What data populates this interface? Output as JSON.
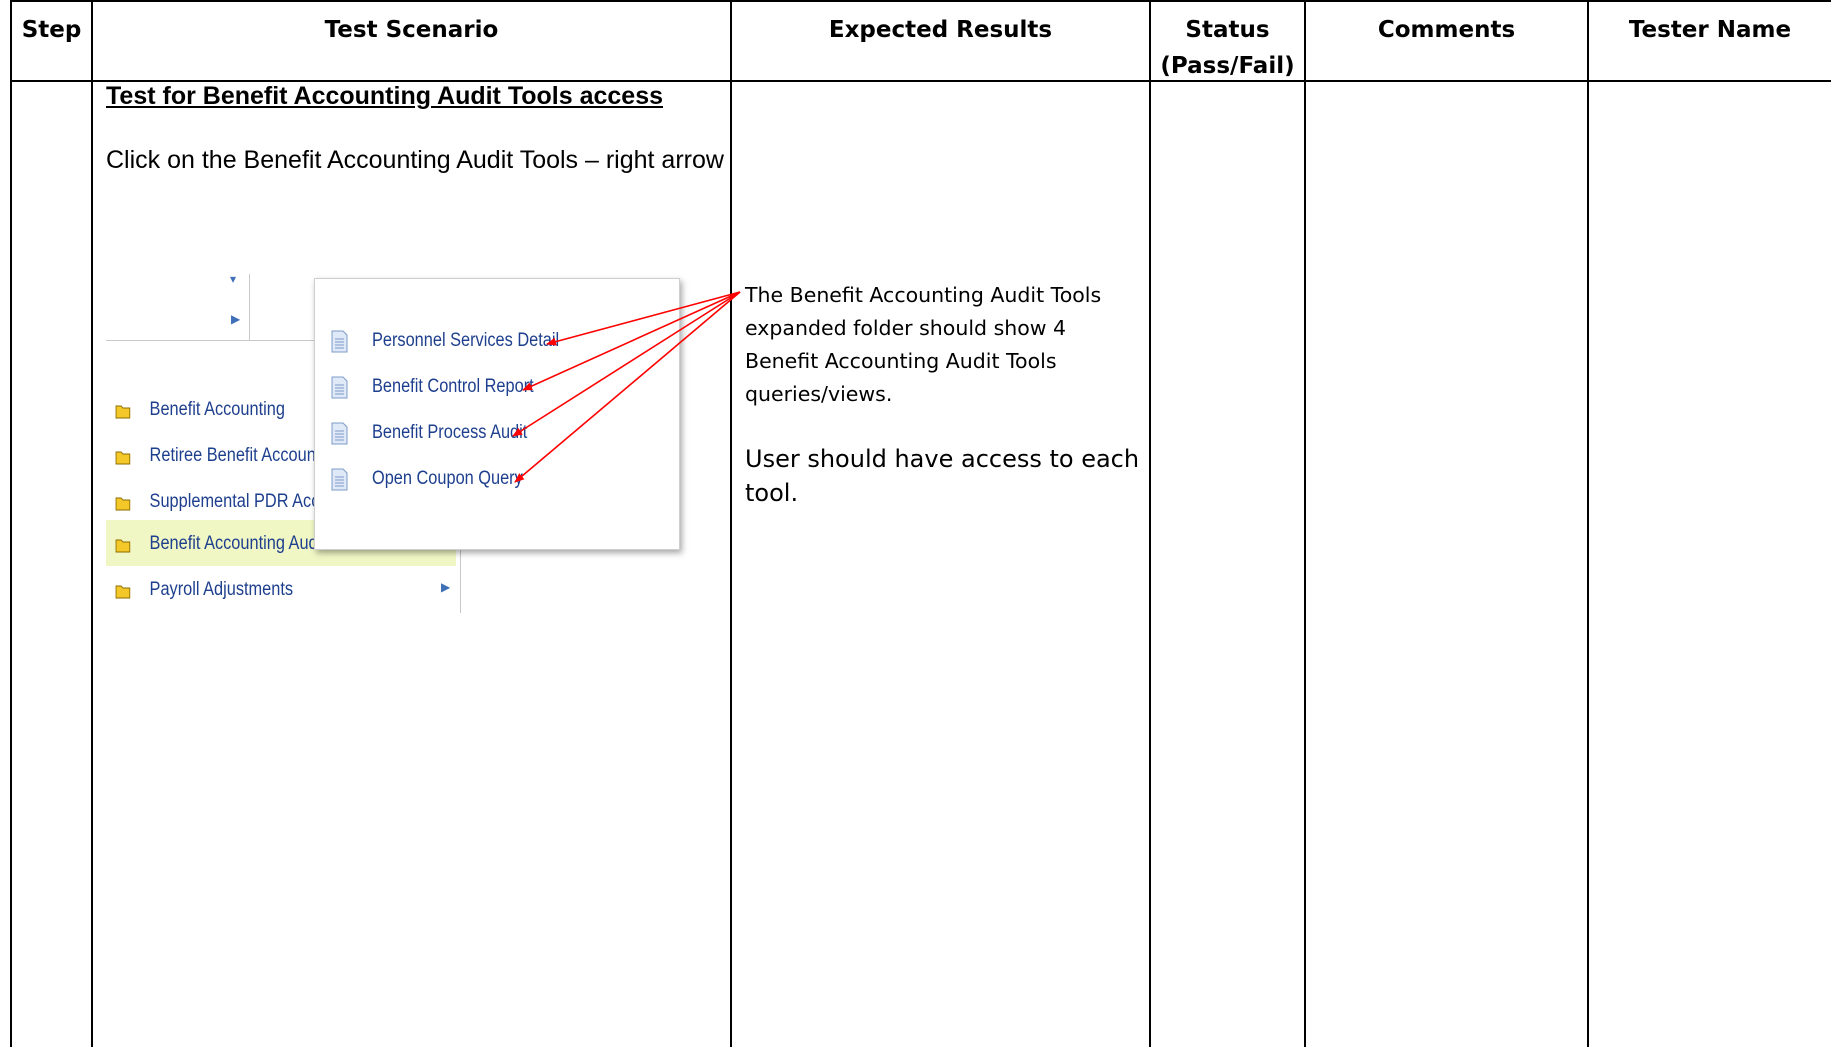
{
  "table": {
    "headers": {
      "step": "Step",
      "scenario": "Test Scenario",
      "expected": "Expected Results",
      "status_line1": "Status",
      "status_line2": "(Pass/Fail)",
      "comments": "Comments",
      "tester": "Tester Name"
    }
  },
  "scenario": {
    "title": "Test for Benefit Accounting Audit Tools access",
    "instruction": "Click on the Benefit Accounting Audit Tools – right arrow"
  },
  "expected": {
    "paragraph1": "The Benefit Accounting Audit Tools expanded folder should show 4 Benefit Accounting Audit Tools queries/views.",
    "paragraph2": "User should have access to each tool."
  },
  "screenshot": {
    "nav_items": [
      {
        "label": "Benefit Accounting",
        "icon": "folder-icon"
      },
      {
        "label": "Retiree Benefit Accounti",
        "icon": "folder-icon"
      },
      {
        "label": "Supplemental PDR Acc",
        "icon": "folder-icon"
      },
      {
        "label": "Benefit Accounting Audit Tools",
        "icon": "folder-icon"
      },
      {
        "label": "Payroll Adjustments",
        "icon": "folder-icon"
      }
    ],
    "popup_items": [
      {
        "label": "Personnel Services Detail",
        "icon": "document-icon"
      },
      {
        "label": "Benefit Control Report",
        "icon": "document-icon"
      },
      {
        "label": "Benefit Process Audit",
        "icon": "document-icon"
      },
      {
        "label": "Open Coupon Query",
        "icon": "document-icon"
      }
    ]
  },
  "colors": {
    "link": "#1d3f8e",
    "highlight": "#f1f7c4",
    "folder": "#f5c829",
    "annotation_arrow": "#ff0000"
  }
}
